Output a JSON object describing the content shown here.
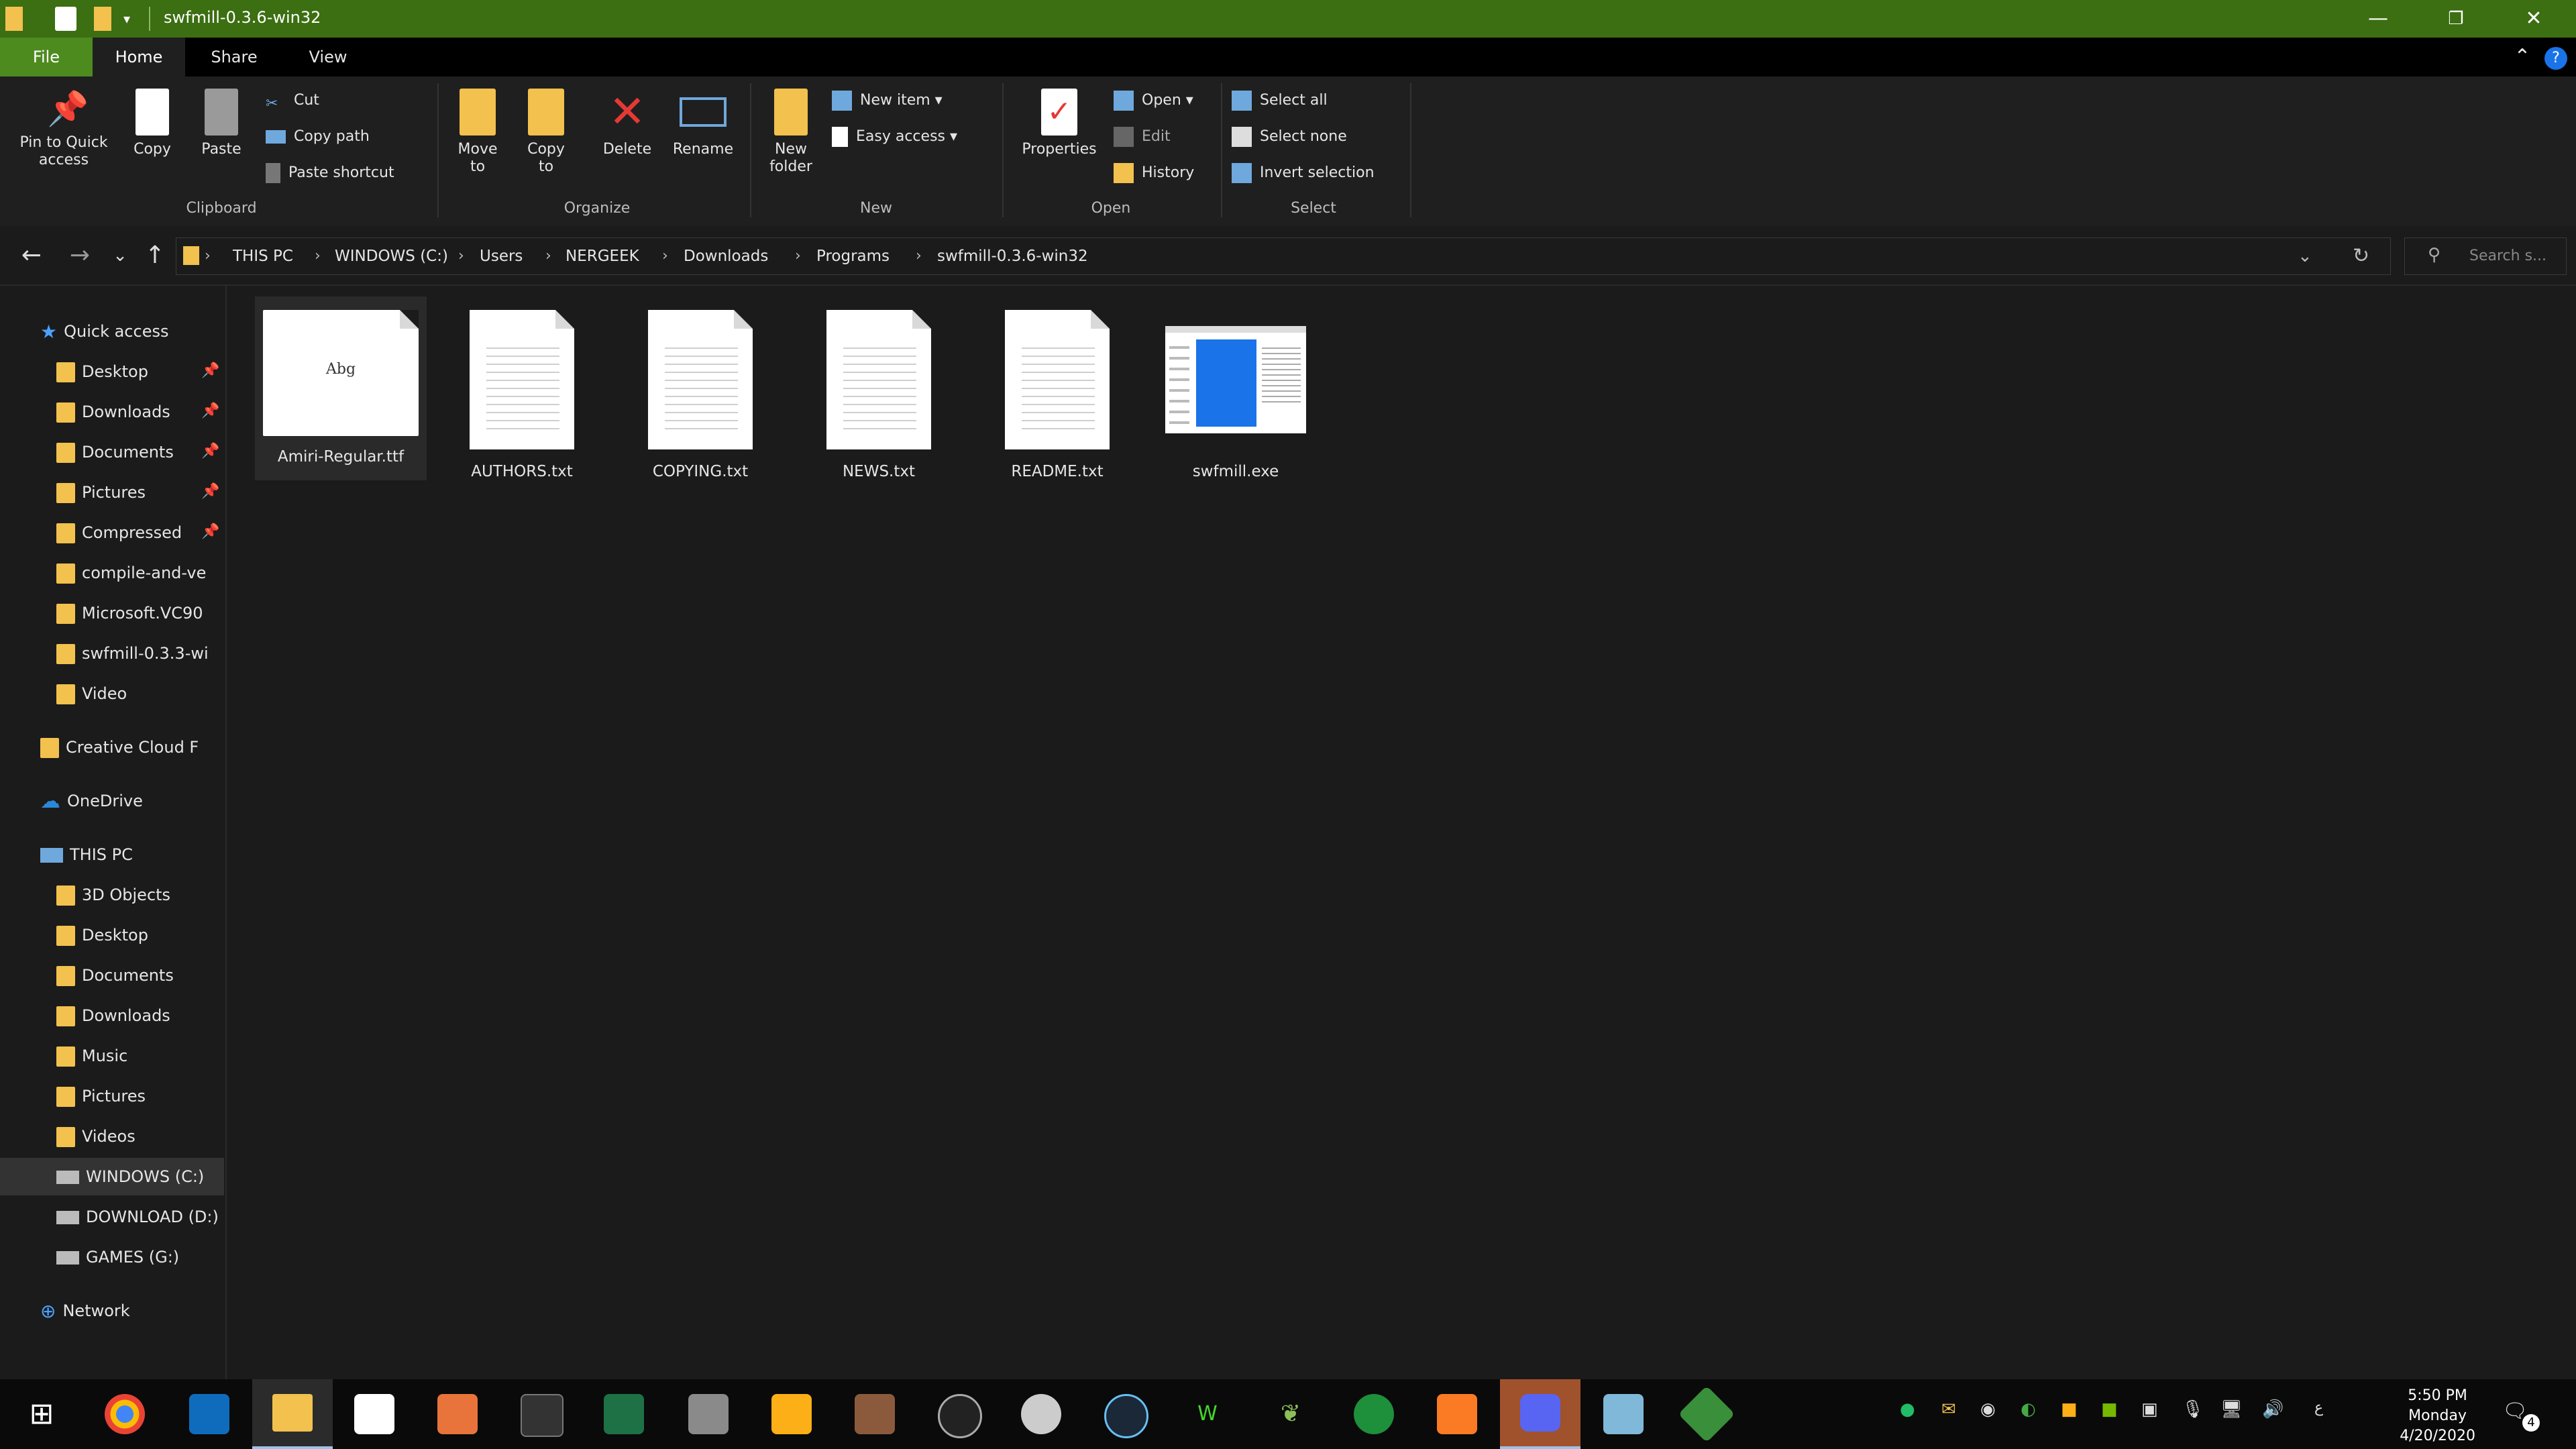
{
  "window": {
    "title": "swfmill-0.3.6-win32"
  },
  "tabs": [
    "File",
    "Home",
    "Share",
    "View"
  ],
  "ribbon": {
    "clipboard": {
      "label": "Clipboard",
      "pin": "Pin to Quick access",
      "copy": "Copy",
      "paste": "Paste",
      "cut": "Cut",
      "copy_path": "Copy path",
      "paste_shortcut": "Paste shortcut"
    },
    "organize": {
      "label": "Organize",
      "move_to": "Move to",
      "copy_to": "Copy to",
      "delete": "Delete",
      "rename": "Rename"
    },
    "new": {
      "label": "New",
      "new_folder": "New folder",
      "new_item": "New item",
      "easy_access": "Easy access"
    },
    "open": {
      "label": "Open",
      "properties": "Properties",
      "open": "Open",
      "edit": "Edit",
      "history": "History"
    },
    "select": {
      "label": "Select",
      "select_all": "Select all",
      "select_none": "Select none",
      "invert": "Invert selection"
    }
  },
  "address": {
    "crumbs": [
      "THIS PC",
      "WINDOWS (C:)",
      "Users",
      "NERGEEK",
      "Downloads",
      "Programs",
      "swfmill-0.3.6-win32"
    ],
    "search_placeholder": "Search s..."
  },
  "nav": {
    "quick_access": "Quick access",
    "quick_items": [
      "Desktop",
      "Downloads",
      "Documents",
      "Pictures",
      "Compressed",
      "compile-and-ve",
      "Microsoft.VC90",
      "swfmill-0.3.3-wi",
      "Video"
    ],
    "creative_cloud": "Creative Cloud F",
    "onedrive": "OneDrive",
    "this_pc": "THIS PC",
    "pc_items": [
      "3D Objects",
      "Desktop",
      "Documents",
      "Downloads",
      "Music",
      "Pictures",
      "Videos",
      "WINDOWS (C:)",
      "DOWNLOAD (D:)",
      "GAMES (G:)"
    ],
    "network": "Network"
  },
  "files": [
    {
      "name": "Amiri-Regular.ttf",
      "preview": "Abg"
    },
    {
      "name": "AUTHORS.txt"
    },
    {
      "name": "COPYING.txt"
    },
    {
      "name": "NEWS.txt"
    },
    {
      "name": "README.txt"
    },
    {
      "name": "swfmill.exe"
    }
  ],
  "clock": {
    "time": "5:50 PM",
    "day": "Monday",
    "date": "4/20/2020"
  },
  "notifications": {
    "count": "4"
  },
  "colors": {
    "titlebar": "#3c6e12",
    "file_tab": "#4e8b1f",
    "folder": "#f2c14e",
    "accent": "#1a73e8"
  }
}
